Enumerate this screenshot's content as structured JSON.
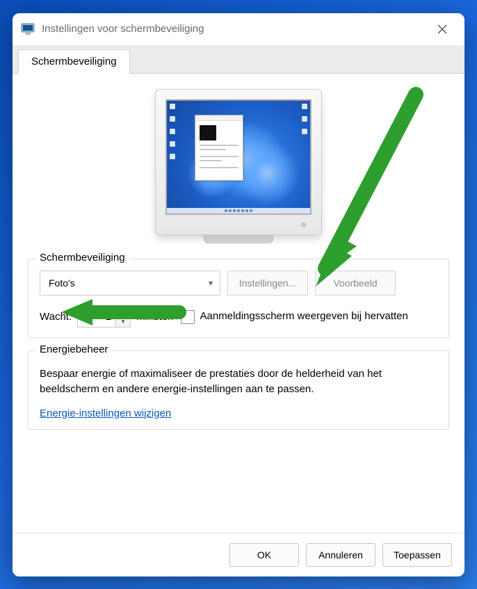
{
  "window": {
    "title": "Instellingen voor schermbeveiliging"
  },
  "tabs": {
    "screensaver": "Schermbeveiliging"
  },
  "screensaver": {
    "group_label": "Schermbeveiliging",
    "dropdown_value": "Foto's",
    "settings_button": "Instellingen...",
    "preview_button": "Voorbeeld",
    "wait_label": "Wacht:",
    "wait_value": "1",
    "wait_unit": "minuten",
    "resume_checkbox_label": "Aanmeldingsscherm weergeven bij hervatten",
    "resume_checked": false
  },
  "energy": {
    "group_label": "Energiebeheer",
    "text": "Bespaar energie of maximaliseer de prestaties door de helderheid van het beeldscherm en andere energie-instellingen aan te passen.",
    "link": "Energie-instellingen wijzigen"
  },
  "footer": {
    "ok": "OK",
    "cancel": "Annuleren",
    "apply": "Toepassen"
  },
  "annotations": {
    "arrow_color": "#2e9e2e"
  }
}
